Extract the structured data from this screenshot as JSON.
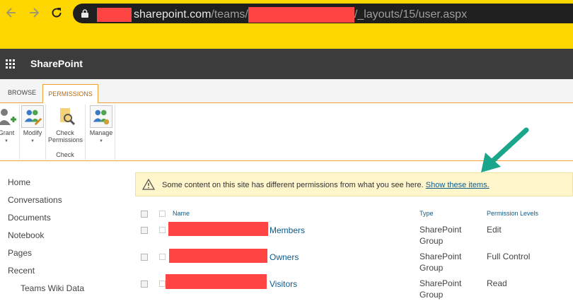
{
  "browser": {
    "url_domain": "sharepoint.com",
    "url_path_start": "/teams/",
    "url_path_end": "/_layouts/15/user.aspx"
  },
  "suite": {
    "title": "SharePoint"
  },
  "ribbon": {
    "tabs": [
      "BROWSE",
      "PERMISSIONS"
    ],
    "buttons": {
      "grant": "Grant",
      "modify": "Modify",
      "check_line1": "Check",
      "check_line2": "Permissions",
      "manage": "Manage"
    },
    "group_check": "Check"
  },
  "leftnav": {
    "items": [
      "Home",
      "Conversations",
      "Documents",
      "Notebook",
      "Pages",
      "Recent"
    ],
    "sub_items": [
      "Teams Wiki Data"
    ]
  },
  "warning": {
    "text": "Some content on this site has different permissions from what you see here.",
    "link": "Show these items."
  },
  "table": {
    "headers": {
      "name": "Name",
      "type": "Type",
      "permission": "Permission Levels"
    },
    "rows": [
      {
        "name": "Members",
        "type_line1": "SharePoint",
        "type_line2": "Group",
        "permission": "Edit"
      },
      {
        "name": "Owners",
        "type_line1": "SharePoint",
        "type_line2": "Group",
        "permission": "Full Control"
      },
      {
        "name": "Visitors",
        "type_line1": "SharePoint",
        "type_line2": "Group",
        "permission": "Read"
      }
    ]
  },
  "colors": {
    "accent": "#f0a030",
    "link": "#0f5a8a",
    "redaction": "#ff4444",
    "arrow": "#1aa68a",
    "warning_bg": "#fff6cc"
  },
  "icons": [
    "back-arrow-icon",
    "forward-arrow-icon",
    "reload-icon",
    "lock-icon",
    "app-launcher-icon",
    "grant-permissions-icon",
    "modify-permissions-icon",
    "check-permissions-icon",
    "manage-icon",
    "warning-icon"
  ]
}
